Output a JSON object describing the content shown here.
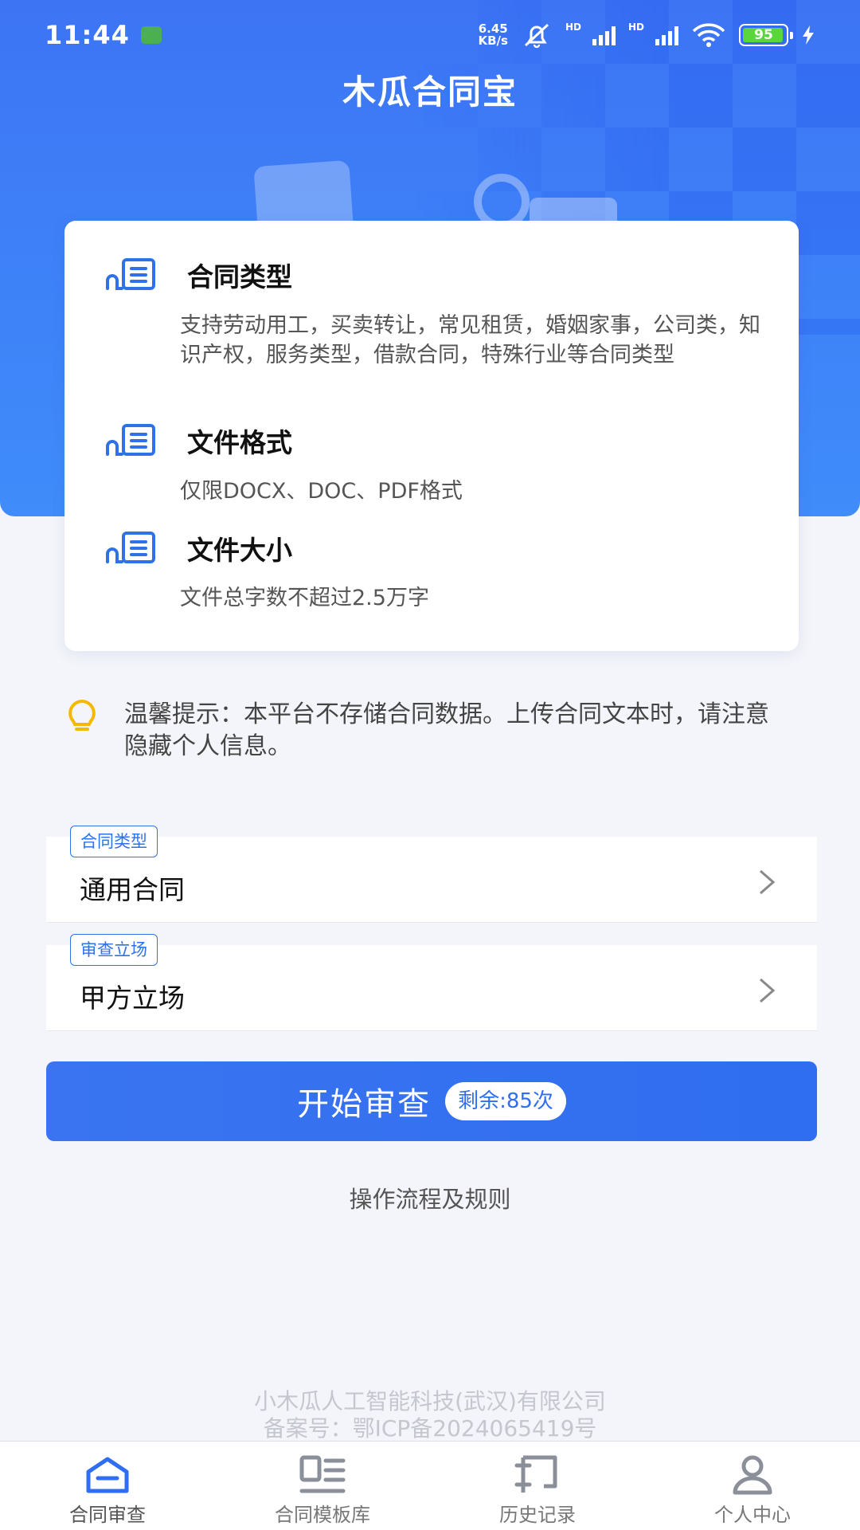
{
  "status_bar": {
    "time": "11:44",
    "net_speed_value": "6.45",
    "net_speed_unit": "KB/s",
    "hd1": "HD",
    "hd2": "HD",
    "battery": "95"
  },
  "app": {
    "title": "木瓜合同宝"
  },
  "info_card": {
    "items": [
      {
        "title": "合同类型",
        "desc": "支持劳动用工，买卖转让，常见租赁，婚姻家事，公司类，知识产权，服务类型，借款合同，特殊行业等合同类型"
      },
      {
        "title": "文件格式",
        "desc": "仅限DOCX、DOC、PDF格式"
      },
      {
        "title": "文件大小",
        "desc": "文件总字数不超过2.5万字"
      }
    ]
  },
  "tip": {
    "text": "温馨提示：本平台不存储合同数据。上传合同文本时，请注意隐藏个人信息。"
  },
  "rows": [
    {
      "tag": "合同类型",
      "value": "通用合同"
    },
    {
      "tag": "审查立场",
      "value": "甲方立场"
    }
  ],
  "start_button": {
    "label": "开始审查",
    "remaining": "剩余:85次"
  },
  "rules_link": "操作流程及规则",
  "footer": {
    "company": "小木瓜人工智能科技(武汉)有限公司",
    "icp": "备案号：鄂ICP备2024065419号"
  },
  "nav": [
    {
      "label": "合同审查",
      "icon": "contract-review-icon",
      "active": true
    },
    {
      "label": "合同模板库",
      "icon": "template-library-icon",
      "active": false
    },
    {
      "label": "历史记录",
      "icon": "history-icon",
      "active": false
    },
    {
      "label": "个人中心",
      "icon": "profile-icon",
      "active": false
    }
  ],
  "colors": {
    "primary": "#2f6ef0",
    "hero": "#3d74f4",
    "tip_icon": "#f5b800",
    "nav_active": "#2f6ef0",
    "nav_inactive": "#8a8f99"
  }
}
